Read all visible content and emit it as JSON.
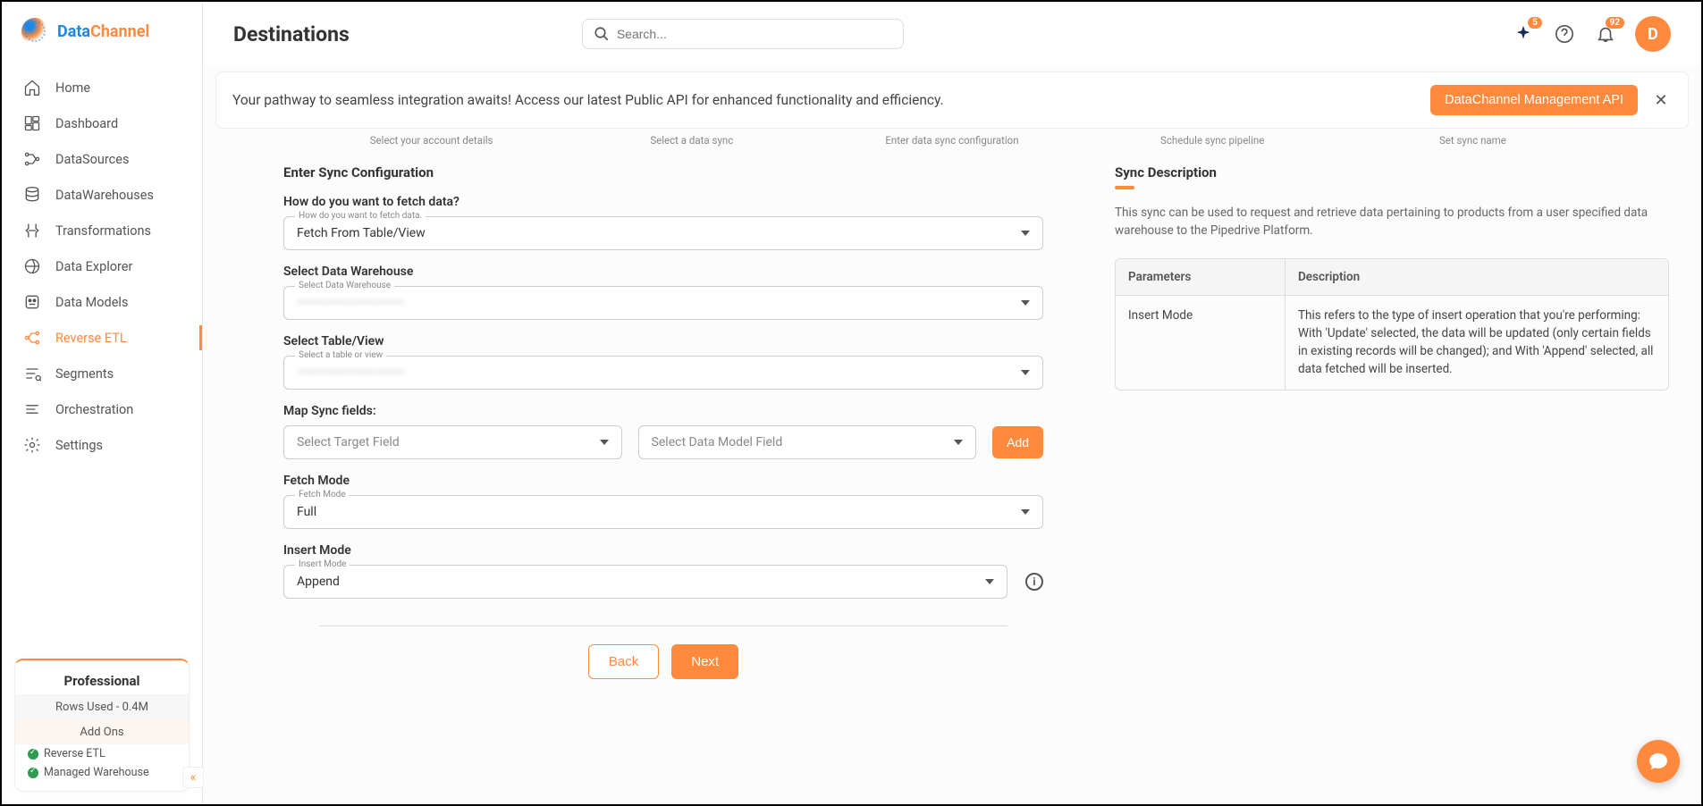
{
  "brand": {
    "name1": "Data",
    "name2": "Channel"
  },
  "sidebar": {
    "items": [
      {
        "label": "Home",
        "icon": "home"
      },
      {
        "label": "Dashboard",
        "icon": "dashboard"
      },
      {
        "label": "DataSources",
        "icon": "datasources"
      },
      {
        "label": "DataWarehouses",
        "icon": "warehouses"
      },
      {
        "label": "Transformations",
        "icon": "transform"
      },
      {
        "label": "Data Explorer",
        "icon": "explorer"
      },
      {
        "label": "Data Models",
        "icon": "models"
      },
      {
        "label": "Reverse ETL",
        "icon": "reverse-etl",
        "active": true
      },
      {
        "label": "Segments",
        "icon": "segments"
      },
      {
        "label": "Orchestration",
        "icon": "orchestration"
      },
      {
        "label": "Settings",
        "icon": "settings"
      }
    ],
    "plan": {
      "title": "Professional",
      "rows_used": "Rows Used - 0.4M",
      "addons_label": "Add Ons",
      "addons": [
        "Reverse ETL",
        "Managed Warehouse"
      ]
    }
  },
  "header": {
    "title": "Destinations",
    "search_placeholder": "Search...",
    "sparkle_badge": "5",
    "bell_badge": "92",
    "avatar_initial": "D"
  },
  "banner": {
    "text": "Your pathway to seamless integration awaits! Access our latest Public API for enhanced functionality and efficiency.",
    "button": "DataChannel Management API"
  },
  "steps": [
    "Select your account details",
    "Select a data sync",
    "Enter data sync configuration",
    "Schedule sync pipeline",
    "Set sync name"
  ],
  "form": {
    "section_title": "Enter Sync Configuration",
    "fetch_question": "How do you want to fetch data?",
    "fetch_float": "How do you want to fetch data.",
    "fetch_value": "Fetch From Table/View",
    "dw_label": "Select Data Warehouse",
    "dw_float": "Select Data Warehouse",
    "dw_value": "———————————",
    "table_label": "Select Table/View",
    "table_float": "Select a table or view",
    "table_value": "———————————",
    "map_label": "Map Sync fields:",
    "target_placeholder": "Select Target Field",
    "model_placeholder": "Select Data Model Field",
    "add_button": "Add",
    "fetch_mode_label": "Fetch Mode",
    "fetch_mode_float": "Fetch Mode",
    "fetch_mode_value": "Full",
    "insert_mode_label": "Insert Mode",
    "insert_mode_float": "Insert Mode",
    "insert_mode_value": "Append",
    "back": "Back",
    "next": "Next"
  },
  "description": {
    "title": "Sync Description",
    "text": "This sync can be used to request and retrieve data pertaining to products from a user specified data warehouse to the Pipedrive Platform.",
    "col_param": "Parameters",
    "col_desc": "Description",
    "rows": [
      {
        "param": "Insert Mode",
        "desc": "This refers to the type of insert operation that you're performing: With 'Update' selected, the data will be updated (only certain fields in existing records will be changed); and With 'Append' selected, all data fetched will be inserted."
      }
    ]
  }
}
